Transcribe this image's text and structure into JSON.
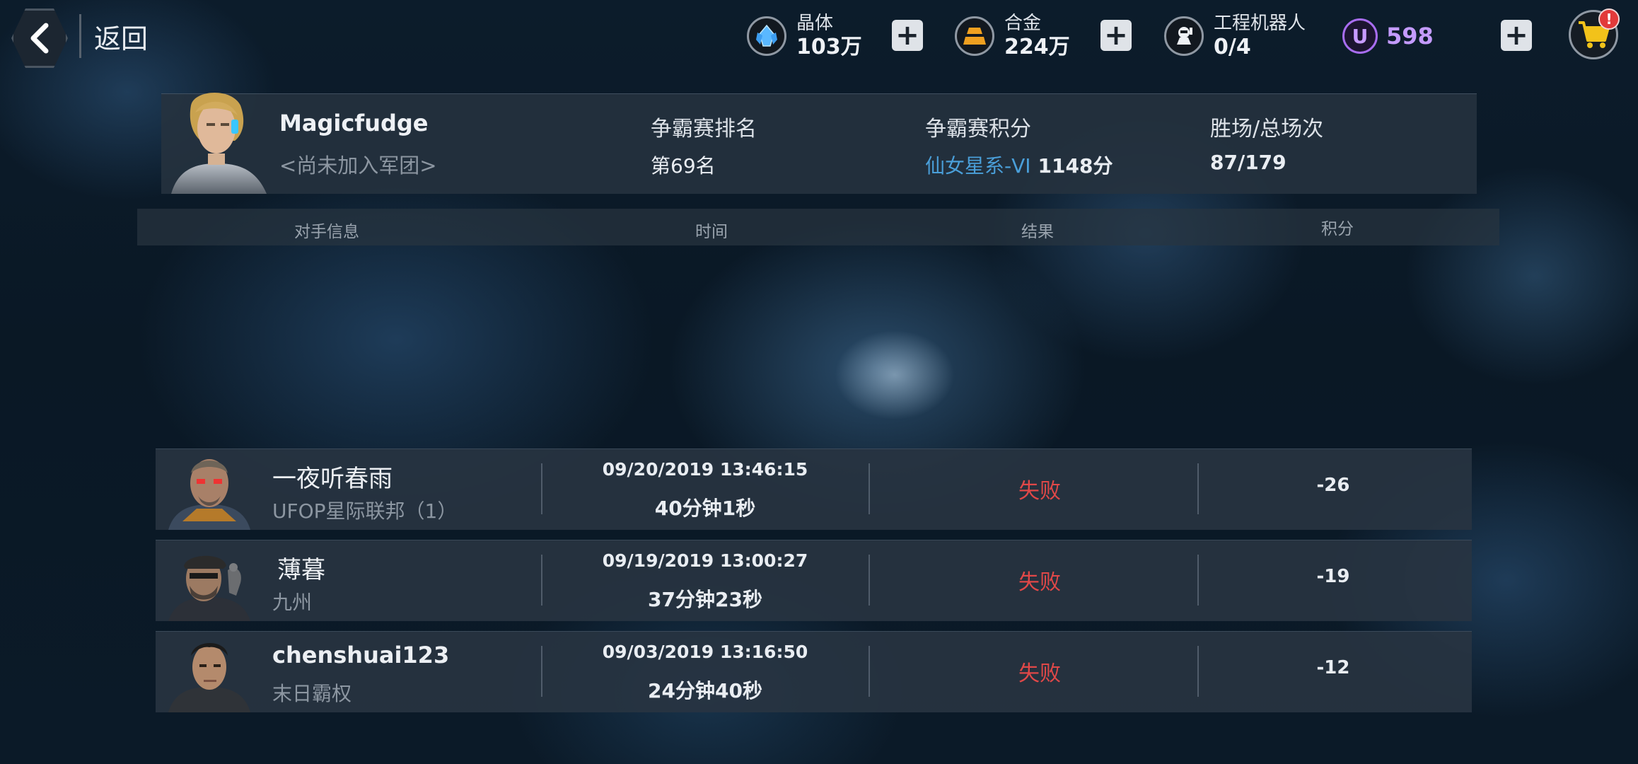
{
  "header": {
    "back_label": "返回",
    "resources": [
      {
        "name": "晶体",
        "value": "103万",
        "icon": "crystal-icon"
      },
      {
        "name": "合金",
        "value": "224万",
        "icon": "alloy-icon"
      },
      {
        "name": "工程机器人",
        "value": "0/4",
        "icon": "robot-icon"
      }
    ],
    "premium": {
      "symbol": "U",
      "value": "598",
      "color": "#c49bff"
    },
    "cart_badge": "!"
  },
  "profile": {
    "name": "Magicfudge",
    "guild": "<尚未加入军团>",
    "rank_label": "争霸赛排名",
    "rank_value": "第69名",
    "points_label": "争霸赛积分",
    "tier": "仙女星系-VI",
    "points_value": "1148分",
    "record_label": "胜场/总场次",
    "record_value": "87/179"
  },
  "table": {
    "headers": [
      "对手信息",
      "时间",
      "结果",
      "积分"
    ],
    "rows": [
      {
        "name": "一夜听春雨",
        "guild": "UFOP星际联邦（1）",
        "date": "09/20/2019 13:46:15",
        "duration": "40分钟1秒",
        "result": "失败",
        "points": "-26"
      },
      {
        "name": "薄暮",
        "guild": "九州",
        "date": "09/19/2019 13:00:27",
        "duration": "37分钟23秒",
        "result": "失败",
        "points": "-19"
      },
      {
        "name": "chenshuai123",
        "guild": "末日霸权",
        "date": "09/03/2019 13:16:50",
        "duration": "24分钟40秒",
        "result": "失败",
        "points": "-12"
      }
    ]
  },
  "colors": {
    "loss": "#e04848",
    "tier": "#4a9fd9",
    "accent_purple": "#a86df0"
  }
}
